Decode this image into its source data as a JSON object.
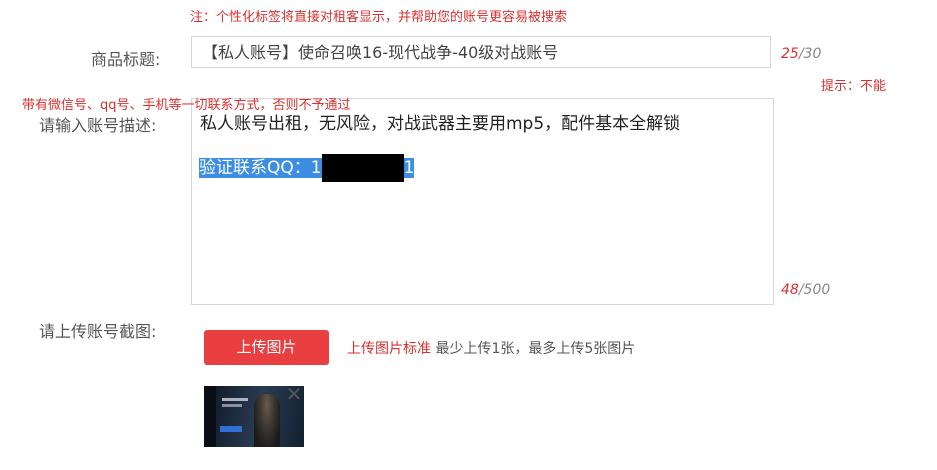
{
  "top_note": "注：个性化标签将直接对租客显示，并帮助您的账号更容易被搜索",
  "title_field": {
    "label": "商品标题:",
    "value": "【私人账号】使命召唤16-现代战争-40级对战账号",
    "count_current": "25",
    "count_max": "/30"
  },
  "hint_right": "提示：不能",
  "hint_left": "带有微信号、qq号、手机等一切联系方式，否则不予通过",
  "description_field": {
    "label": "请输入账号描述:",
    "line1": "私人账号出租，无风险，对战武器主要用mp5，配件基本全解锁",
    "line2_prefix": "验证联系QQ：1",
    "line2_suffix": "1",
    "count_current": "48",
    "count_max": "/500"
  },
  "upload": {
    "label": "请上传账号截图:",
    "button_label": "上传图片",
    "standard_label": "上传图片标准",
    "standard_text": " 最少上传1张，最多上传5张图片",
    "remove_icon": "close-icon",
    "remove_glyph": "✕"
  },
  "colors": {
    "accent_red": "#d9302f",
    "button_red": "#ea3f41",
    "selection_blue": "#3d8ee2"
  }
}
